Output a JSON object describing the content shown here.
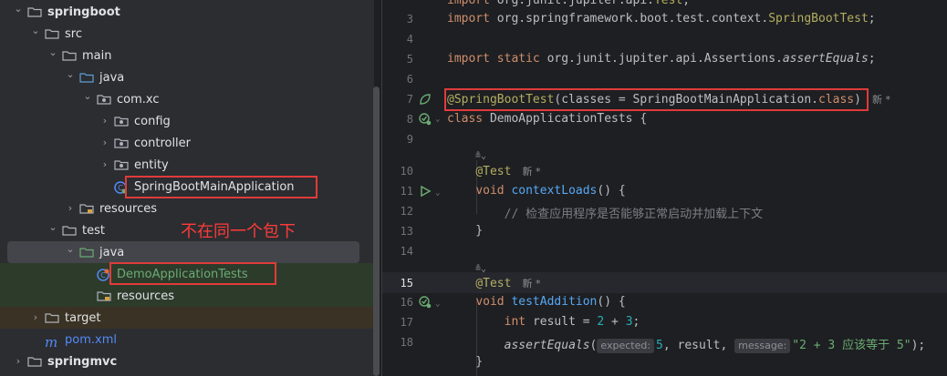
{
  "tree": {
    "items": [
      {
        "label": "springboot",
        "type": "folder",
        "expanded": true,
        "bold": true
      },
      {
        "label": "src",
        "type": "folder",
        "expanded": true
      },
      {
        "label": "main",
        "type": "folder",
        "expanded": true
      },
      {
        "label": "java",
        "type": "src-folder",
        "expanded": true
      },
      {
        "label": "com.xc",
        "type": "package",
        "expanded": true
      },
      {
        "label": "config",
        "type": "package",
        "expanded": false
      },
      {
        "label": "controller",
        "type": "package",
        "expanded": false
      },
      {
        "label": "entity",
        "type": "package",
        "expanded": false
      },
      {
        "label": "SpringBootMainApplication",
        "type": "class"
      },
      {
        "label": "resources",
        "type": "res-folder",
        "expanded": false
      },
      {
        "label": "test",
        "type": "folder",
        "expanded": true
      },
      {
        "label": "java",
        "type": "test-folder",
        "expanded": true
      },
      {
        "label": "DemoApplicationTests",
        "type": "test-class"
      },
      {
        "label": "resources",
        "type": "res-folder"
      },
      {
        "label": "target",
        "type": "folder",
        "expanded": false
      },
      {
        "label": "pom.xml",
        "type": "maven"
      },
      {
        "label": "springmvc",
        "type": "folder",
        "expanded": false,
        "bold": true
      }
    ],
    "annotation": "不在同一个包下"
  },
  "editor": {
    "lines": [
      {
        "n": "",
        "tokens": [
          [
            "kw",
            "import "
          ],
          [
            "",
            "org.junit.jupiter.api."
          ],
          [
            "ann",
            "Test"
          ],
          [
            "",
            ";"
          ]
        ]
      },
      {
        "n": "3",
        "tokens": [
          [
            "kw",
            "import "
          ],
          [
            "",
            "org.springframework.boot.test.context."
          ],
          [
            "ann",
            "SpringBootTest"
          ],
          [
            "",
            ";"
          ]
        ]
      },
      {
        "n": "4",
        "tokens": []
      },
      {
        "n": "5",
        "tokens": [
          [
            "kw",
            "import static "
          ],
          [
            "",
            "org.junit.jupiter.api.Assertions."
          ],
          [
            "it",
            "assertEquals"
          ],
          [
            "",
            ";"
          ]
        ]
      },
      {
        "n": "6",
        "tokens": []
      },
      {
        "n": "7",
        "tokens": [
          [
            "ann",
            "@SpringBootTest"
          ],
          [
            "",
            "(classes = SpringBootMainApplication."
          ],
          [
            "kw",
            "class"
          ],
          [
            "",
            ")"
          ]
        ],
        "suffix": "新 *"
      },
      {
        "n": "8",
        "tokens": [
          [
            "kw",
            "class "
          ],
          [
            "",
            "DemoApplicationTests {"
          ]
        ]
      },
      {
        "n": "9",
        "tokens": []
      },
      {
        "n": "",
        "tokens": [],
        "hint": "≗⌄"
      },
      {
        "n": "10",
        "tokens": [
          [
            "",
            "    "
          ],
          [
            "ann",
            "@Test"
          ]
        ],
        "suffix": "新 *"
      },
      {
        "n": "11",
        "tokens": [
          [
            "",
            "    "
          ],
          [
            "kw",
            "void "
          ],
          [
            "fn",
            "contextLoads"
          ],
          [
            "",
            "() {"
          ]
        ]
      },
      {
        "n": "12",
        "tokens": [
          [
            "",
            "        "
          ],
          [
            "cmt",
            "// 检查应用程序是否能够正常启动并加载上下文"
          ]
        ]
      },
      {
        "n": "13",
        "tokens": [
          [
            "",
            "    }"
          ]
        ]
      },
      {
        "n": "14",
        "tokens": []
      },
      {
        "n": "",
        "tokens": [],
        "hint": "≗⌄"
      },
      {
        "n": "15",
        "tokens": [
          [
            "",
            "    "
          ],
          [
            "ann",
            "@Test"
          ]
        ],
        "suffix": "新 *"
      },
      {
        "n": "16",
        "tokens": [
          [
            "",
            "    "
          ],
          [
            "kw",
            "void "
          ],
          [
            "fn",
            "testAddition"
          ],
          [
            "",
            "() {"
          ]
        ]
      },
      {
        "n": "17",
        "tokens": [
          [
            "",
            "        "
          ],
          [
            "kw",
            "int "
          ],
          [
            "",
            "result = "
          ],
          [
            "num",
            "2"
          ],
          [
            "",
            " + "
          ],
          [
            "num",
            "3"
          ],
          [
            "",
            ";"
          ]
        ]
      },
      {
        "n": "18",
        "tokens": [
          [
            "",
            "        "
          ],
          [
            "it",
            "assertEquals"
          ],
          [
            "",
            "("
          ],
          [
            "hint",
            "expected:"
          ],
          [
            "num",
            "5"
          ],
          [
            "",
            ", result, "
          ],
          [
            "hint",
            "message:"
          ],
          [
            "str",
            "\"2 + 3 应该等于 5\""
          ],
          [
            "",
            ");"
          ]
        ]
      },
      {
        "n": "",
        "tokens": [
          [
            "",
            "    }"
          ]
        ]
      }
    ]
  },
  "colors": {
    "accent_red": "#e03b3b",
    "bg": "#1e1f22",
    "panel": "#2b2d30"
  }
}
